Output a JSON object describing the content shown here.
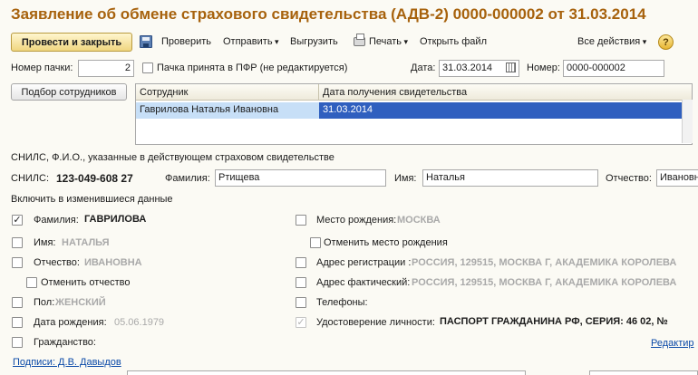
{
  "title": "Заявление об обмене страхового свидетельства (АДВ-2) 0000-000002 от 31.03.2014",
  "toolbar": {
    "post_close": "Провести и закрыть",
    "check": "Проверить",
    "send": "Отправить",
    "export": "Выгрузить",
    "print": "Печать",
    "open_file": "Открыть файл",
    "all_actions": "Все действия",
    "help": "?"
  },
  "header_fields": {
    "pack_label": "Номер пачки:",
    "pack_value": "2",
    "pack_accepted_label": "Пачка принята в ПФР (не редактируется)",
    "date_label": "Дата:",
    "date_value": "31.03.2014",
    "number_label": "Номер:",
    "number_value": "0000-000002"
  },
  "select_employees": "Подбор сотрудников",
  "grid": {
    "col_employee": "Сотрудник",
    "col_date": "Дата получения свидетельства",
    "rows": [
      {
        "employee": "Гаврилова Наталья Ивановна",
        "date": "31.03.2014"
      }
    ]
  },
  "current_cert": {
    "caption": "СНИЛС, Ф.И.О., указанные в действующем страховом свидетельстве",
    "snils_label": "СНИЛС:",
    "snils_value": "123-049-608 27",
    "surname_label": "Фамилия:",
    "surname_value": "Ртищева",
    "name_label": "Имя:",
    "name_value": "Наталья",
    "patronymic_label": "Отчество:",
    "patronymic_value": "Ивановна"
  },
  "changes": {
    "caption": "Включить в изменившиеся данные",
    "surname_label": "Фамилия:",
    "surname_value": "ГАВРИЛОВА",
    "name_label": "Имя:",
    "name_value": "НАТАЛЬЯ",
    "patronymic_label": "Отчество:",
    "patronymic_value": "ИВАНОВНА",
    "cancel_patronymic": "Отменить отчество",
    "sex_label": "Пол:",
    "sex_value": "ЖЕНСКИЙ",
    "birthdate_label": "Дата рождения:",
    "birthdate_value": "05.06.1979",
    "citizenship_label": "Гражданство:",
    "birthplace_label": "Место рождения:",
    "birthplace_value": "МОСКВА",
    "cancel_birthplace": "Отменить место рождения",
    "reg_address_label": "Адрес регистрации :",
    "reg_address_value": "РОССИЯ, 129515, МОСКВА Г, АКАДЕМИКА КОРОЛЕВА",
    "actual_address_label": "Адрес фактический:",
    "actual_address_value": "РОССИЯ, 129515, МОСКВА Г, АКАДЕМИКА КОРОЛЕВА",
    "phones_label": "Телефоны:",
    "id_doc_label": "Удостоверение личности:",
    "id_doc_value": "ПАСПОРТ ГРАЖДАНИНА РФ, СЕРИЯ: 46 02, №",
    "edit_link": "Редактир"
  },
  "signatures_link": "Подписи: Д.В. Давыдов"
}
